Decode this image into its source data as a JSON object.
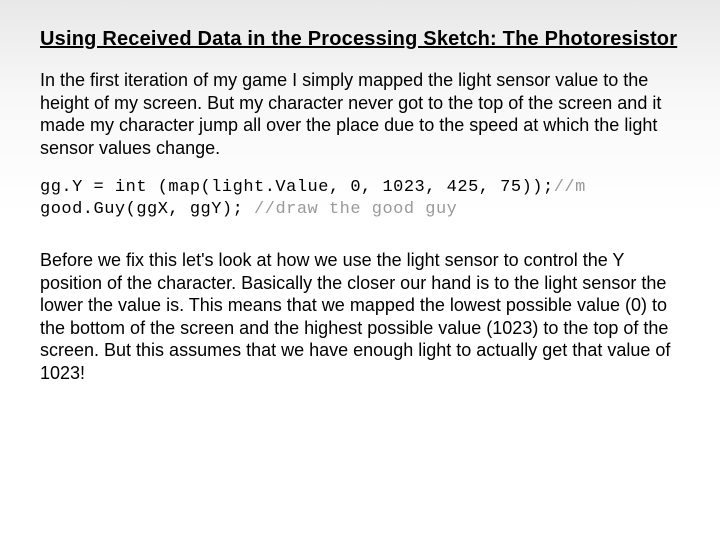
{
  "title": "Using Received Data in the Processing Sketch: The Photoresistor",
  "para1": "In the first iteration of my game I simply mapped the light sensor value to the height of my screen. But my character never got to the top of the screen and it made my character jump all over the place due to the speed at which the light sensor values change.",
  "code": {
    "line1_a": "gg.Y = int (map(light.Value, 0, 1023, 425, 75));",
    "line1_b": "//m",
    "line2_a": "good.Guy(ggX, ggY); ",
    "line2_b": "//draw the good guy"
  },
  "para2": "Before we fix this let's look at how we use the light sensor to control the Y position of the character. Basically the closer our hand is to the light sensor the lower the value is. This means that we mapped the lowest possible value (0) to the bottom of the screen and the highest possible value (1023) to the top of the screen. But this assumes that we have enough light to actually get that value of 1023!"
}
